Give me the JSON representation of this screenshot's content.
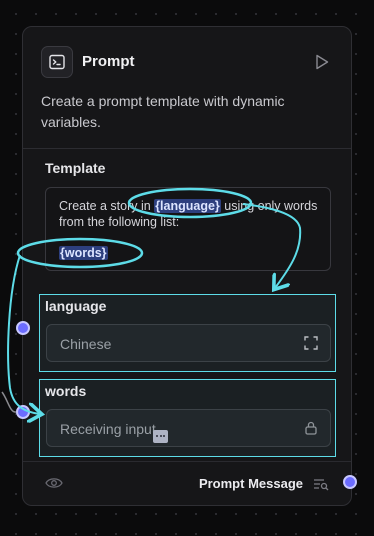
{
  "node": {
    "title": "Prompt",
    "description": "Create a prompt template with dynamic variables.",
    "icon": "terminal-icon"
  },
  "template": {
    "label": "Template",
    "text_before": "Create a story in ",
    "var1": "{language}",
    "text_after": " using only words from the following list:",
    "var2": "{words}"
  },
  "fields": {
    "language": {
      "label": "language",
      "value": "Chinese",
      "icon": "expand-icon"
    },
    "words": {
      "label": "words",
      "placeholder": "Receiving input",
      "icon": "lock-icon"
    }
  },
  "footer": {
    "output_label": "Prompt Message",
    "visibility_icon": "eye-icon",
    "output_icon": "message-search-icon"
  },
  "colors": {
    "annotation": "#5ddce8",
    "handle": "#6c6cff",
    "variable_highlight": "#2d3f7e"
  }
}
